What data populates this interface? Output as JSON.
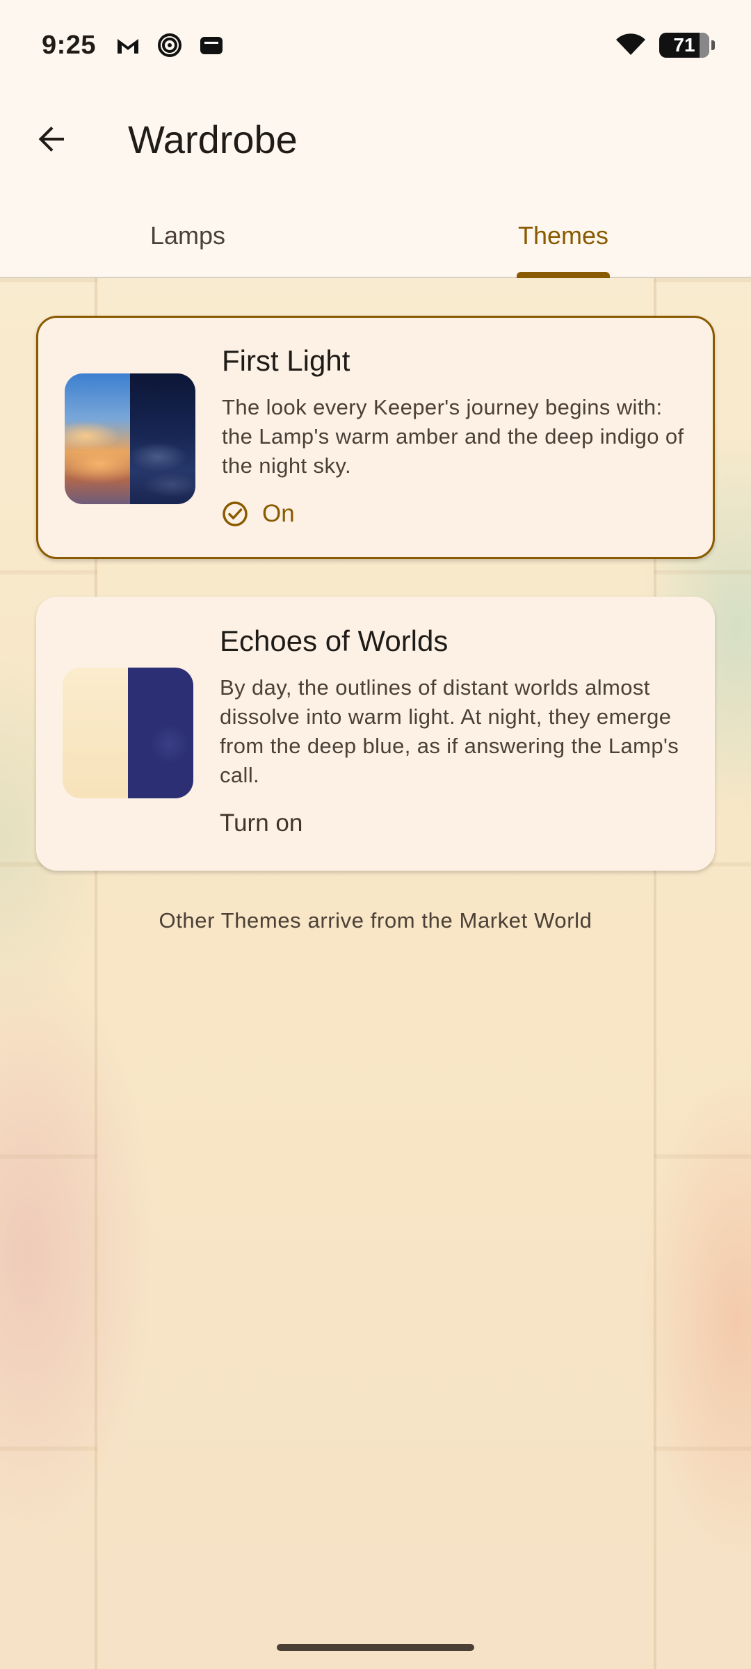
{
  "status_bar": {
    "time": "9:25",
    "icons": [
      "gmail-icon",
      "spiral-icon",
      "wallet-icon"
    ],
    "wifi": "wifi-icon",
    "battery": "71"
  },
  "app_bar": {
    "back_icon": "arrow-left-icon",
    "title": "Wardrobe"
  },
  "tabs": [
    {
      "label": "Lamps",
      "active": false
    },
    {
      "label": "Themes",
      "active": true
    }
  ],
  "themes": [
    {
      "title": "First Light",
      "description": "The look every Keeper's journey begins with: the Lamp's warm amber and the deep indigo of the night sky.",
      "status_label": "On",
      "selected": true
    },
    {
      "title": "Echoes of Worlds",
      "description": "By day, the outlines of distant worlds almost dissolve into warm light. At night, they emerge from the deep blue, as if answering the Lamp's call.",
      "action_label": "Turn on",
      "selected": false
    }
  ],
  "footer_note": "Other Themes arrive from the Market World",
  "colors": {
    "accent": "#8a5a00",
    "background": "#fdf7f0",
    "card": "#fdf1e6",
    "text": "#1f1b16"
  }
}
